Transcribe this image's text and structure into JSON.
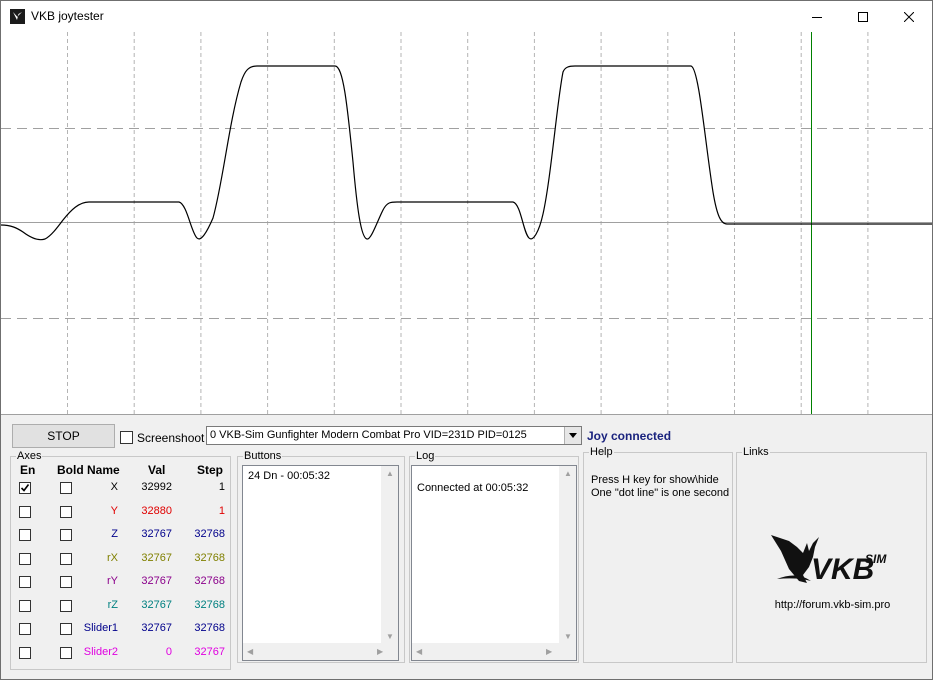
{
  "window": {
    "title": "VKB joytester"
  },
  "toolbar": {
    "stop_label": "STOP",
    "screenshoot_label": "Screenshoot",
    "screenshoot_checked": false,
    "device_selected": "0  VKB-Sim Gunfighter Modern Combat Pro  VID=231D PID=0125",
    "status": "Joy connected",
    "status_color": "#1a237e"
  },
  "axes": {
    "title": "Axes",
    "headers": {
      "en": "En",
      "bold": "Bold",
      "name": "Name",
      "val": "Val",
      "step": "Step"
    },
    "rows": [
      {
        "name": "X",
        "val": "32992",
        "step": "1",
        "enabled": true,
        "bold": false,
        "color": "#000000"
      },
      {
        "name": "Y",
        "val": "32880",
        "step": "1",
        "enabled": false,
        "bold": false,
        "color": "#e00000"
      },
      {
        "name": "Z",
        "val": "32767",
        "step": "32768",
        "enabled": false,
        "bold": false,
        "color": "#00008b"
      },
      {
        "name": "rX",
        "val": "32767",
        "step": "32768",
        "enabled": false,
        "bold": false,
        "color": "#808000"
      },
      {
        "name": "rY",
        "val": "32767",
        "step": "32768",
        "enabled": false,
        "bold": false,
        "color": "#8b008b"
      },
      {
        "name": "rZ",
        "val": "32767",
        "step": "32768",
        "enabled": false,
        "bold": false,
        "color": "#008080"
      },
      {
        "name": "Slider1",
        "val": "32767",
        "step": "32768",
        "enabled": false,
        "bold": false,
        "color": "#00008b"
      },
      {
        "name": "Slider2",
        "val": "0",
        "step": "32767",
        "enabled": false,
        "bold": false,
        "color": "#e000e0"
      }
    ]
  },
  "buttons_panel": {
    "title": "Buttons",
    "entries": [
      "24 Dn - 00:05:32"
    ]
  },
  "log_panel": {
    "title": "Log",
    "entries": [
      "Connected at 00:05:32"
    ]
  },
  "help_panel": {
    "title": "Help",
    "lines": [
      "Press H key for show\\hide",
      "One \"dot line\" is one second"
    ]
  },
  "links_panel": {
    "title": "Links",
    "logo_text": "VKB",
    "logo_sub": "SIM",
    "url": "http://forum.vkb-sim.pro"
  },
  "graph": {
    "trace_color": "#000000",
    "cursor_color": "#008000",
    "grid_color": "#b4b4b4"
  }
}
